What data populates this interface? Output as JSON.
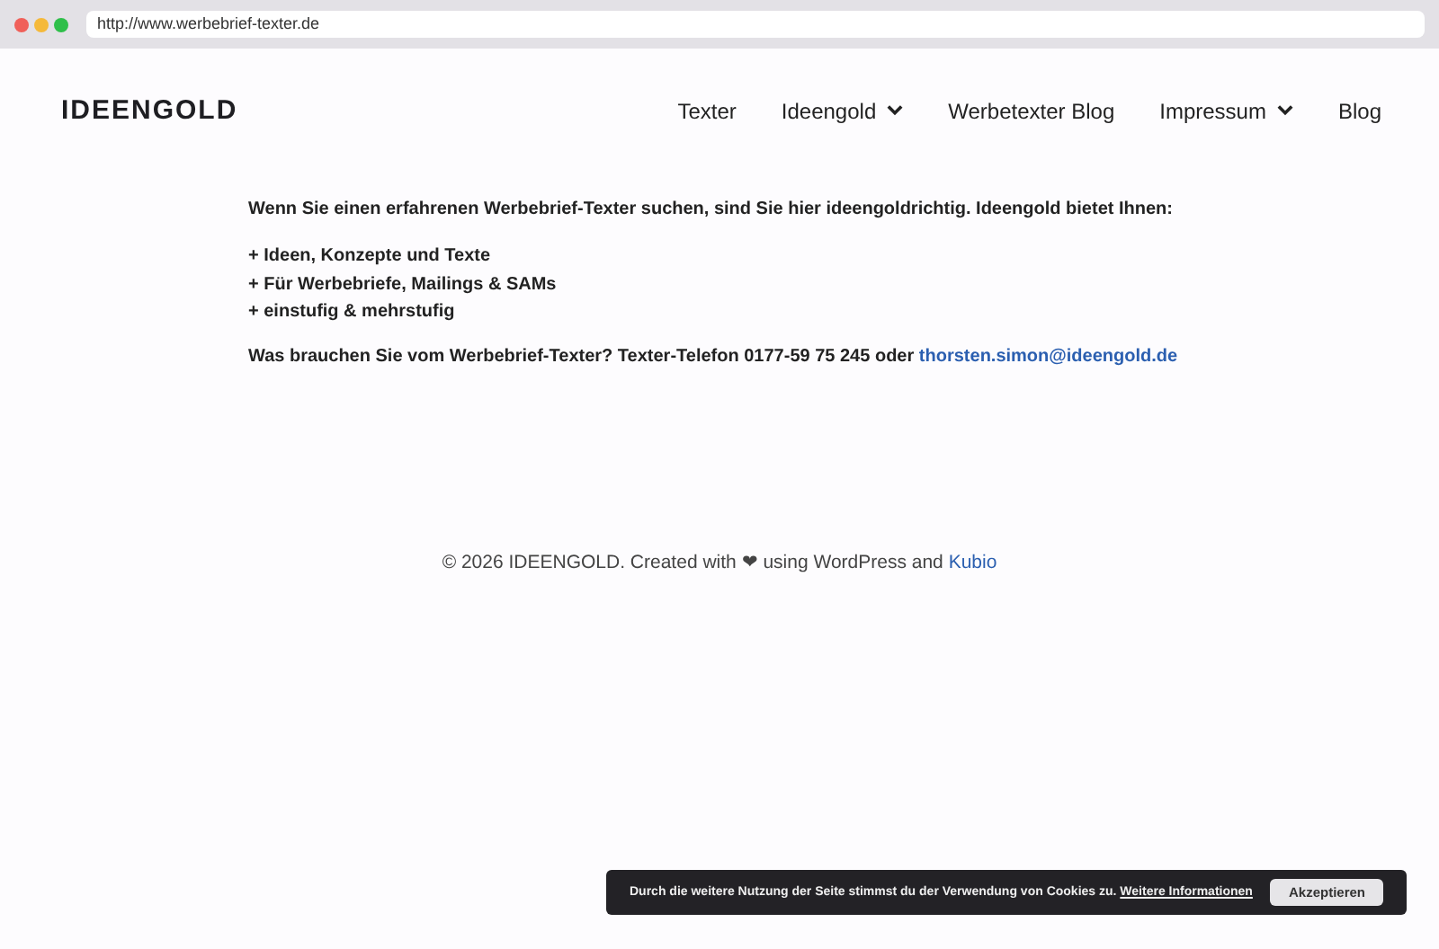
{
  "browser": {
    "url": "http://www.werbebrief-texter.de"
  },
  "header": {
    "logo": "IDEENGOLD",
    "nav": [
      {
        "label": "Texter",
        "has_dropdown": false
      },
      {
        "label": "Ideengold",
        "has_dropdown": true
      },
      {
        "label": "Werbetexter Blog",
        "has_dropdown": false
      },
      {
        "label": "Impressum",
        "has_dropdown": true
      },
      {
        "label": "Blog",
        "has_dropdown": false
      }
    ]
  },
  "content": {
    "intro": "Wenn Sie einen erfahrenen Werbebrief-Texter suchen, sind Sie hier ideengoldrichtig. Ideengold bietet Ihnen:",
    "bullets": [
      "+ Ideen, Konzepte und Texte",
      "+ Für Werbebriefe, Mailings & SAMs",
      "+ einstufig & mehrstufig"
    ],
    "contact": "Was brauchen Sie vom Werbebrief-Texter? Texter-Telefon 0177-59 75 245 oder",
    "email": "thorsten.simon@ideengold.de"
  },
  "footer": {
    "text": "© 2026 IDEENGOLD. Created with ❤ using WordPress and",
    "link": "Kubio"
  },
  "cookie_bar": {
    "message": "Durch die weitere Nutzung der Seite stimmst du der Verwendung von Cookies zu.",
    "link": "Weitere Informationen",
    "button": "Akzeptieren"
  }
}
